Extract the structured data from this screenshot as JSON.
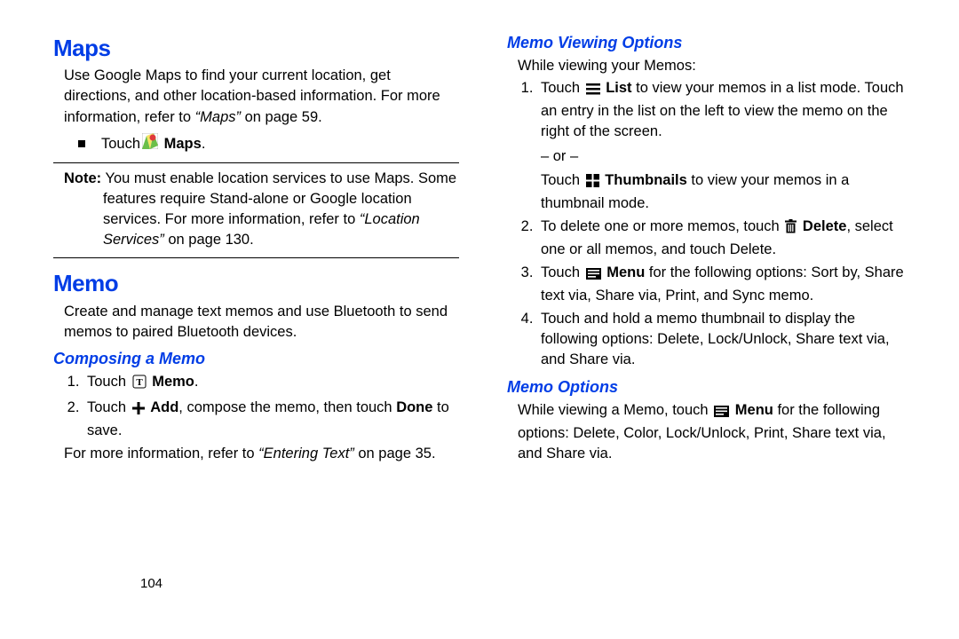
{
  "page_number": "104",
  "left": {
    "maps_h": "Maps",
    "maps_desc_a": "Use Google Maps to find your current location, get directions, and other location-based information. For more information, refer to ",
    "maps_desc_ref": "“Maps”",
    "maps_desc_b": " on page 59.",
    "maps_touch": "Touch ",
    "maps_label": "Maps",
    "note_label": "Note:",
    "note_body_a": "You must enable location services to use Maps. Some features require Stand-alone or Google location services. For more information, refer to ",
    "note_ref": "“Location Services”",
    "note_body_b": " on page 130.",
    "memo_h": "Memo",
    "memo_desc": "Create and manage text memos and use Bluetooth to send memos to paired Bluetooth devices.",
    "compose_h": "Composing a Memo",
    "compose_1a": "Touch ",
    "compose_1_label": "Memo",
    "compose_2a": "Touch ",
    "compose_2_label": "Add",
    "compose_2b": ", compose the memo, then touch ",
    "compose_2_done": "Done",
    "compose_2c": " to save.",
    "compose_more_a": "For more information, refer to ",
    "compose_more_ref": "“Entering Text”",
    "compose_more_b": " on page 35."
  },
  "right": {
    "view_h": "Memo Viewing Options",
    "view_intro": "While viewing your Memos:",
    "v1a": "Touch ",
    "v1_label": "List",
    "v1b": " to view your memos in a list mode. Touch an entry in the list on the left to view the memo on the right of the screen.",
    "or": "– or –",
    "v1c": "Touch ",
    "v1_label2": "Thumbnails",
    "v1d": " to view your memos in a thumbnail mode.",
    "v2a": "To delete one or more memos, touch ",
    "v2_label": "Delete",
    "v2b": ", select one or all memos, and touch Delete.",
    "v3a": "Touch ",
    "v3_label": "Menu",
    "v3b": " for the following options: Sort by, Share text via, Share via, Print, and Sync memo.",
    "v4": "Touch and hold a memo thumbnail to display the following options: Delete, Lock/Unlock, Share text via, and Share via.",
    "opts_h": "Memo Options",
    "opts_a": "While viewing a Memo, touch ",
    "opts_label": "Menu",
    "opts_b": " for the following options: Delete, Color, Lock/Unlock, Print, Share text via, and Share via."
  }
}
